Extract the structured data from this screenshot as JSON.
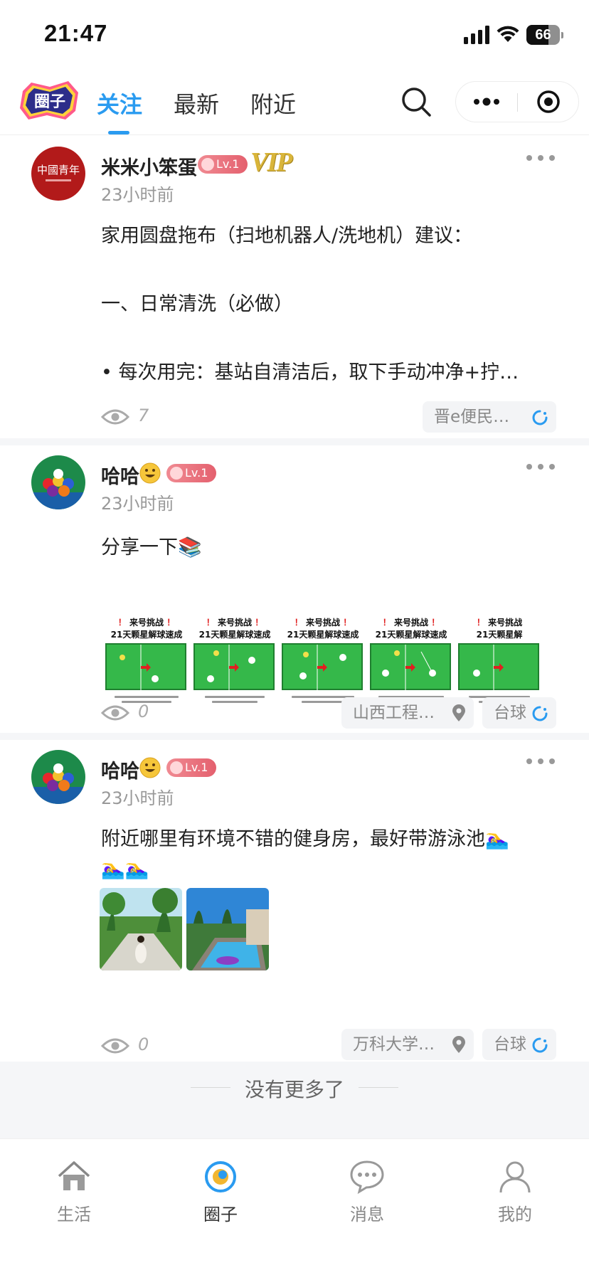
{
  "status_bar": {
    "time": "21:47",
    "battery": "66",
    "battery_level": 0.66
  },
  "header": {
    "logo_text": "圈子",
    "tabs": [
      {
        "label": "关注",
        "active": true
      },
      {
        "label": "最新",
        "active": false
      },
      {
        "label": "附近",
        "active": false
      }
    ]
  },
  "posts": [
    {
      "username": "米米小笨蛋",
      "level": "Lv.1",
      "vip": "VIP",
      "avatar_text": "中國青年",
      "time": "23小时前",
      "content_lines": [
        "家用圆盘拖布（扫地机器人/洗地机）建议：",
        "一、日常清洗（必做）",
        "• 每次用完：基站自清洁后，取下手动冲净+拧…"
      ],
      "views": "7",
      "tags": [
        "晋e便民…"
      ]
    },
    {
      "username": "哈哈",
      "level": "Lv.1",
      "time": "23小时前",
      "content": "分享一下📚",
      "thumbnails": [
        {
          "title_pre": "！",
          "title_mid": "来号挑战",
          "title_main": "21天颗星解球速成"
        },
        {
          "title_pre": "！",
          "title_mid": "来号挑战",
          "title_main": "21天颗星解球速成"
        },
        {
          "title_pre": "！",
          "title_mid": "来号挑战",
          "title_main": "21天颗星解球速成"
        },
        {
          "title_pre": "！",
          "title_mid": "来号挑战",
          "title_main": "21天颗星解球速成"
        },
        {
          "title_pre": "！",
          "title_mid": "来号挑战",
          "title_main": "21天颗星解"
        }
      ],
      "views": "0",
      "location": "山西工程…",
      "topic": "台球"
    },
    {
      "username": "哈哈",
      "level": "Lv.1",
      "time": "23小时前",
      "content_line1": "附近哪里有环境不错的健身房，最好带游泳池🏊‍♀️",
      "content_line2": "🏊‍♀️🏊‍♀️",
      "views": "0",
      "location": "万科大学…",
      "topic": "台球"
    }
  ],
  "footer": {
    "no_more": "没有更多了"
  },
  "bottom_nav": [
    {
      "label": "生活",
      "icon": "home-icon",
      "active": false
    },
    {
      "label": "圈子",
      "icon": "circle-icon",
      "active": true
    },
    {
      "label": "消息",
      "icon": "chat-icon",
      "active": false
    },
    {
      "label": "我的",
      "icon": "profile-icon",
      "active": false
    }
  ],
  "colors": {
    "accent": "#2a9bf0",
    "level_badge": "#e4606e",
    "vip": "#d9b53a"
  }
}
